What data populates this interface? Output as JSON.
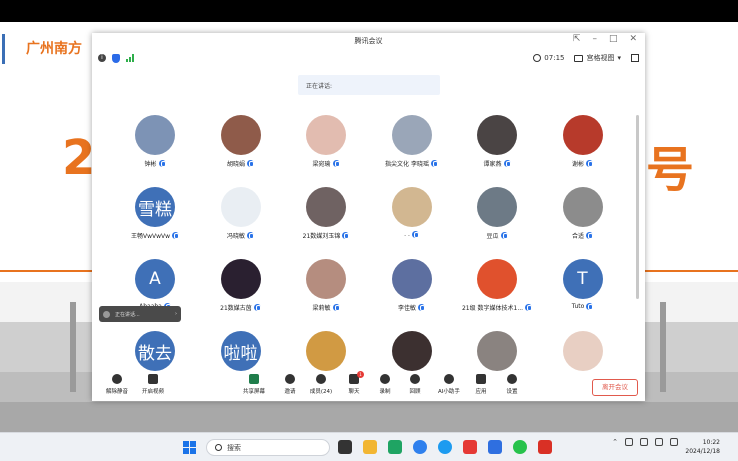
{
  "slide": {
    "title": "广州南方",
    "big_left": "2",
    "big_right": "号"
  },
  "window": {
    "title": "腾讯会议",
    "timer": "07:15",
    "view_label": "宫格视图",
    "speaking_label": "正在讲话:"
  },
  "participants": [
    {
      "name": "钟彬",
      "avatar_text": "",
      "color": "#7d93b5"
    },
    {
      "name": "胡晓娟",
      "avatar_text": "",
      "color": "#8f5b4a"
    },
    {
      "name": "梁宛瑜",
      "avatar_text": "",
      "color": "#e2bcb0"
    },
    {
      "name": "指尖文化 李晓瑶",
      "avatar_text": "",
      "color": "#9aa6b8"
    },
    {
      "name": "谭家燕",
      "avatar_text": "",
      "color": "#4a4444"
    },
    {
      "name": "谢彬",
      "avatar_text": "",
      "color": "#b73a2b"
    },
    {
      "name": "王畅VwVwVw",
      "avatar_text": "雪糕",
      "color": "#3f70b7"
    },
    {
      "name": "冯晓敏",
      "avatar_text": "",
      "color": "#e9eef3"
    },
    {
      "name": "21数媒刘玉锦",
      "avatar_text": "",
      "color": "#6f6262"
    },
    {
      "name": ". .",
      "avatar_text": "",
      "color": "#d2b791"
    },
    {
      "name": "豆瓜",
      "avatar_text": "",
      "color": "#6d7a86"
    },
    {
      "name": "合适",
      "avatar_text": "",
      "color": "#8c8c8c"
    },
    {
      "name": "Abaaba",
      "avatar_text": "A",
      "color": "#3f70b7"
    },
    {
      "name": "21数媒古茵",
      "avatar_text": "",
      "color": "#2a2030"
    },
    {
      "name": "梁莉敏",
      "avatar_text": "",
      "color": "#b58d7f"
    },
    {
      "name": "李佳敏",
      "avatar_text": "",
      "color": "#5d6fa0"
    },
    {
      "name": "21级 数字媒体技术1...",
      "avatar_text": "",
      "color": "#e0512d"
    },
    {
      "name": "Tuto",
      "avatar_text": "T",
      "color": "#3f70b7"
    },
    {
      "name": "",
      "avatar_text": "散去",
      "color": "#3f70b7"
    },
    {
      "name": "",
      "avatar_text": "啦啦",
      "color": "#3f70b7"
    },
    {
      "name": "",
      "avatar_text": "",
      "color": "#d19a43"
    },
    {
      "name": "",
      "avatar_text": "",
      "color": "#3c3030"
    },
    {
      "name": "",
      "avatar_text": "",
      "color": "#8a8380"
    },
    {
      "name": "",
      "avatar_text": "",
      "color": "#e8cfc3"
    }
  ],
  "mini_control": {
    "label": "正在讲话..."
  },
  "toolbar": {
    "mute": "解除静音",
    "video": "开启视频",
    "share": "共享屏幕",
    "invite": "邀请",
    "members": "成员(24)",
    "chat": "聊天",
    "chat_badge": "1",
    "record": "录制",
    "review": "回顾",
    "ai": "AI小助手",
    "apps": "应用",
    "settings": "设置",
    "leave": "离开会议"
  },
  "taskbar": {
    "search_placeholder": "搜索",
    "time": "10:22",
    "date": "2024/12/18"
  }
}
